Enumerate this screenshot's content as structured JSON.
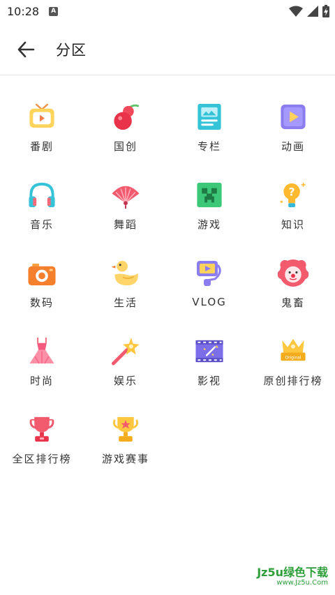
{
  "status": {
    "time": "10:28",
    "notif_letter": "A"
  },
  "header": {
    "title": "分区"
  },
  "categories": [
    {
      "label": "番剧",
      "icon": "tv-icon"
    },
    {
      "label": "国创",
      "icon": "gourd-icon"
    },
    {
      "label": "专栏",
      "icon": "article-icon"
    },
    {
      "label": "动画",
      "icon": "animation-icon"
    },
    {
      "label": "音乐",
      "icon": "headphones-icon"
    },
    {
      "label": "舞蹈",
      "icon": "fan-icon"
    },
    {
      "label": "游戏",
      "icon": "creeper-icon"
    },
    {
      "label": "知识",
      "icon": "bulb-icon"
    },
    {
      "label": "数码",
      "icon": "camera-icon"
    },
    {
      "label": "生活",
      "icon": "duck-icon"
    },
    {
      "label": "VLOG",
      "icon": "vlog-icon"
    },
    {
      "label": "鬼畜",
      "icon": "clown-icon"
    },
    {
      "label": "时尚",
      "icon": "dress-icon"
    },
    {
      "label": "娱乐",
      "icon": "wand-icon"
    },
    {
      "label": "影视",
      "icon": "film-icon"
    },
    {
      "label": "原创排行榜",
      "icon": "original-crown-icon"
    },
    {
      "label": "全区排行榜",
      "icon": "red-trophy-icon"
    },
    {
      "label": "游戏赛事",
      "icon": "gold-trophy-icon"
    }
  ],
  "watermark": {
    "line1": "Jz5u绿色下载",
    "line2": "www.Jz5u.Com"
  },
  "colors": {
    "accent": "#fb7299",
    "divider": "#e5e5e5"
  }
}
